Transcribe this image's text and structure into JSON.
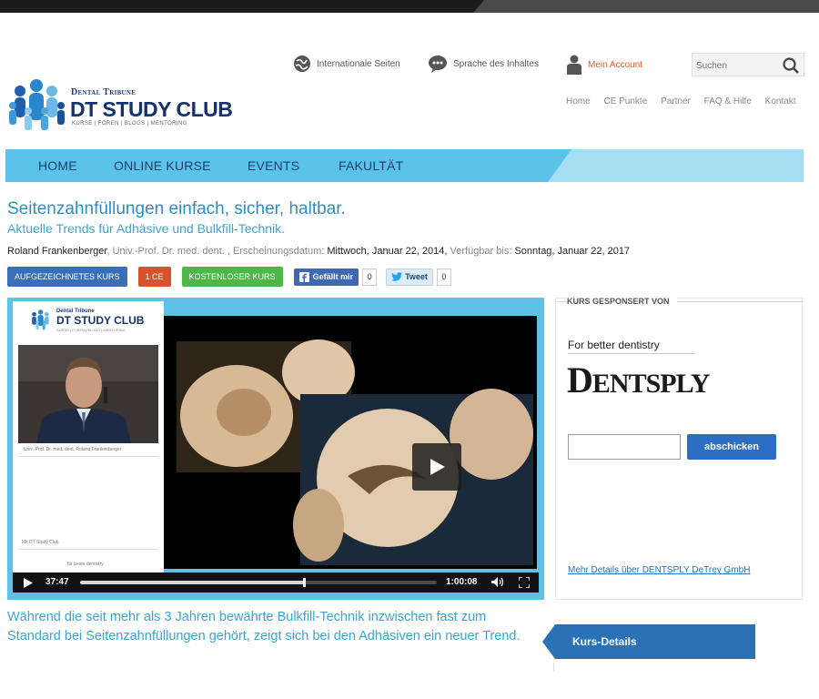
{
  "header": {
    "brand_top": "Dental Tribune",
    "brand": "DT STUDY CLUB",
    "brand_sub": "KURSE | FOREN | BLOGS | MENTORING",
    "utility": {
      "international": "Internationale Seiten",
      "language": "Sprache des Inhaltes",
      "account": "Mein Account"
    },
    "search_placeholder": "Suchen",
    "secondary_nav": [
      "Home",
      "CE Punkte",
      "Partner",
      "FAQ & Hilfe",
      "Kontakt"
    ]
  },
  "main_nav": [
    "HOME",
    "ONLINE KURSE",
    "EVENTS",
    "FAKULTÄT"
  ],
  "course": {
    "title": "Seitenzahnfüllungen einfach, sicher, haltbar.",
    "subtitle": "Aktuelle Trends für Adhäsive und Bulkfill-Technik.",
    "author": "Roland Frankenberger",
    "credentials": ", Univ.-Prof. Dr. med. dent. , Erscheinungsdatum:",
    "published": " Mittwoch, Januar 22, 2014,",
    "available_label": " Verfügbar bis:",
    "available_until": " Sonntag, Januar 22, 2017",
    "badges": {
      "recorded": "AUFGEZEICHNETES KURS",
      "ce": "1 CE",
      "free": "KOSTENLOSER KURS"
    },
    "social": {
      "like_label": "Gefällt mir",
      "like_count": "0",
      "tweet_label": "Tweet",
      "tweet_count": "0"
    },
    "description": "Während die seit mehr als 3 Jahren bewährte Bulkfill-Technik inzwischen fast zum Standard bei Seitenzahnfüllungen gehört, zeigt sich bei den Adhäsiven ein neuer Trend."
  },
  "player": {
    "current_time": "37:47",
    "duration": "1:00:08",
    "progress": 0.628,
    "slide_brand_top": "Dental Tribune",
    "slide_brand": "DT STUDY CLUB",
    "slide_brand_sub": "KURSE | FOREN | BLOGS | MENTORING",
    "slide_caption": "Univ.-Prof. Dr. med. dent. Roland Frankenberger",
    "slide_note": "Mit DT Study Club",
    "slide_footer": "für beste dentistry"
  },
  "sponsor": {
    "heading": "KURS GESPONSERT VON",
    "tagline": "For better dentistry",
    "logo_word_big": "D",
    "logo_word_rest": "ENTSPLY",
    "submit_label": "abschicken",
    "more_link": "Mehr Details über DENTSPLY DeTrey GmbH"
  },
  "details_tab": "Kurs-Details",
  "colors": {
    "nav": "#5bc3ea",
    "title": "#2a8fc8",
    "accent_blue": "#2a72b5",
    "account": "#e05a2a"
  }
}
